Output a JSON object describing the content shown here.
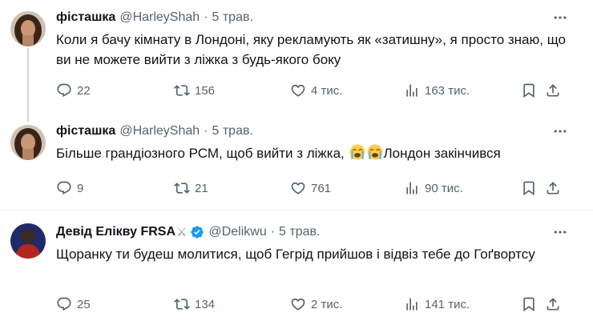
{
  "tweets": [
    {
      "name": "фісташка",
      "handle": "@HarleyShah",
      "dot": "·",
      "time": "5 трав.",
      "text": "Коли я бачу кімнату в Лондоні, яку рекламують як «затишну», я просто знаю, що ви не можете вийти з ліжка з будь-якого боку",
      "replies": "22",
      "reposts": "156",
      "likes": "4 тис.",
      "views": "163 тис."
    },
    {
      "name": "фісташка",
      "handle": "@HarleyShah",
      "dot": "·",
      "time": "5 трав.",
      "text_before": "Більше грандіозного РСМ, щоб вийти з ліжка,",
      "text_after": "Лондон закінчився",
      "emoji_name": "loudly-crying-face",
      "replies": "9",
      "reposts": "21",
      "likes": "761",
      "views": "90 тис."
    },
    {
      "name": "Девід Елікву FRSA",
      "name_suffix_icon": "crossed-swords",
      "handle": "@Delikwu",
      "dot": "·",
      "time": "5 трав.",
      "verified": true,
      "text": "Щоранку ти будеш молитися, щоб Гегрід прийшов і відвіз тебе до Гоґвортсу",
      "replies": "25",
      "reposts": "134",
      "likes": "2 тис.",
      "views": "141 тис."
    }
  ],
  "colors": {
    "primary_text": "#0f1419",
    "secondary_text": "#536471",
    "verified_blue": "#1d9bf0",
    "divider": "#eff3f4",
    "thread_line": "#cfd9de"
  }
}
